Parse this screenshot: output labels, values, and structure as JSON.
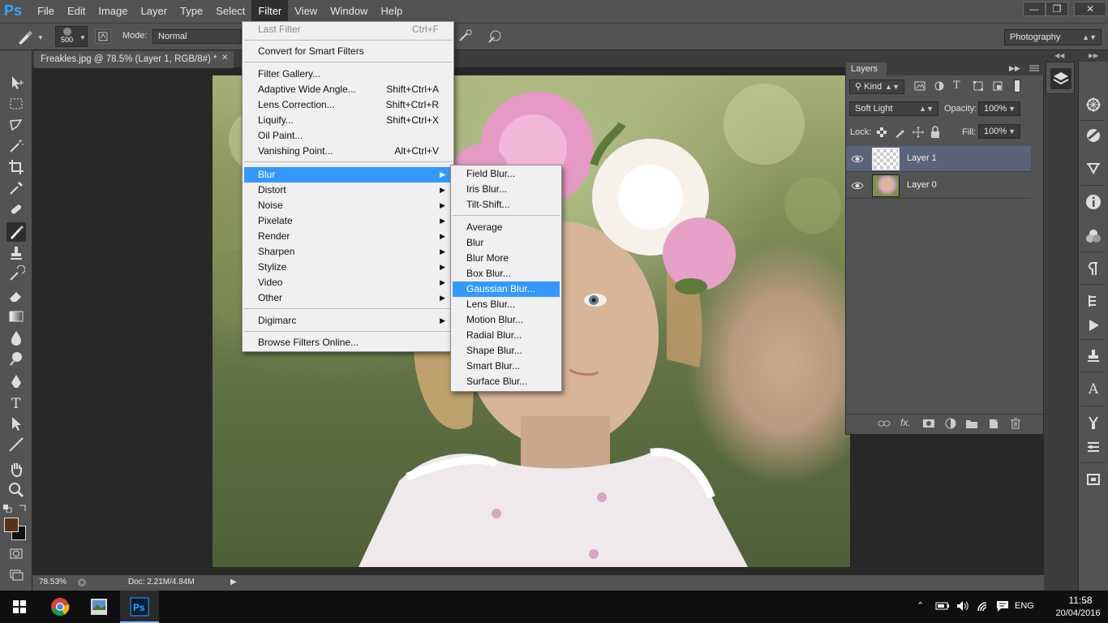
{
  "app": {
    "logo": "Ps",
    "menu": [
      "File",
      "Edit",
      "Image",
      "Layer",
      "Type",
      "Select",
      "Filter",
      "View",
      "Window",
      "Help"
    ],
    "active_menu": "Filter"
  },
  "options_bar": {
    "brush_size": "500",
    "mode_label": "Mode:",
    "mode_value": "Normal",
    "workspace": "Photography"
  },
  "document": {
    "tab_title": "Freakles.jpg @ 78.5% (Layer 1, RGB/8#) *",
    "zoom": "78.53%",
    "doc_size": "Doc: 2.21M/4.84M"
  },
  "filter_menu": {
    "last_filter": {
      "label": "Last Filter",
      "shortcut": "Ctrl+F"
    },
    "convert_smart": "Convert for Smart Filters",
    "gallery_items": [
      {
        "label": "Filter Gallery...",
        "shortcut": ""
      },
      {
        "label": "Adaptive Wide Angle...",
        "shortcut": "Shift+Ctrl+A"
      },
      {
        "label": "Lens Correction...",
        "shortcut": "Shift+Ctrl+R"
      },
      {
        "label": "Liquify...",
        "shortcut": "Shift+Ctrl+X"
      },
      {
        "label": "Oil Paint...",
        "shortcut": ""
      },
      {
        "label": "Vanishing Point...",
        "shortcut": "Alt+Ctrl+V"
      }
    ],
    "submenus": [
      "Blur",
      "Distort",
      "Noise",
      "Pixelate",
      "Render",
      "Sharpen",
      "Stylize",
      "Video",
      "Other"
    ],
    "digimarc": "Digimarc",
    "browse_online": "Browse Filters Online..."
  },
  "blur_menu": {
    "gallery_items": [
      "Field Blur...",
      "Iris Blur...",
      "Tilt-Shift..."
    ],
    "items": [
      "Average",
      "Blur",
      "Blur More",
      "Box Blur...",
      "Gaussian Blur...",
      "Lens Blur...",
      "Motion Blur...",
      "Radial Blur...",
      "Shape Blur...",
      "Smart Blur...",
      "Surface Blur..."
    ],
    "highlighted": "Gaussian Blur..."
  },
  "layers_panel": {
    "tab": "Layers",
    "filter_kind": "Kind",
    "blend_mode": "Soft Light",
    "opacity_label": "Opacity:",
    "opacity": "100%",
    "lock_label": "Lock:",
    "fill_label": "Fill:",
    "fill": "100%",
    "layers": [
      {
        "name": "Layer 1",
        "selected": true
      },
      {
        "name": "Layer 0",
        "selected": false
      }
    ]
  },
  "taskbar": {
    "time": "11:58",
    "date": "20/04/2016",
    "lang": "ENG"
  }
}
